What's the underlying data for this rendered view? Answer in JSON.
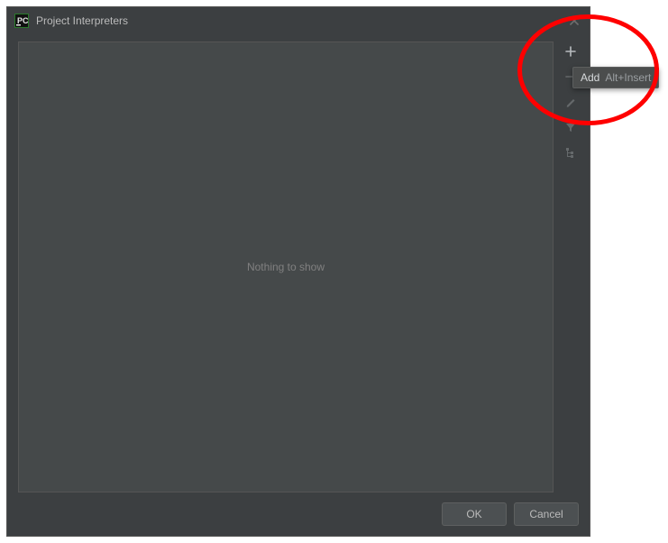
{
  "dialog": {
    "title": "Project Interpreters",
    "empty_text": "Nothing to show",
    "buttons": {
      "ok": "OK",
      "cancel": "Cancel"
    }
  },
  "tooltip": {
    "label": "Add",
    "shortcut": "Alt+Insert"
  },
  "toolbar": {
    "add": "add-icon",
    "remove": "remove-icon",
    "edit": "edit-icon",
    "filter": "filter-icon",
    "paths": "paths-icon"
  }
}
